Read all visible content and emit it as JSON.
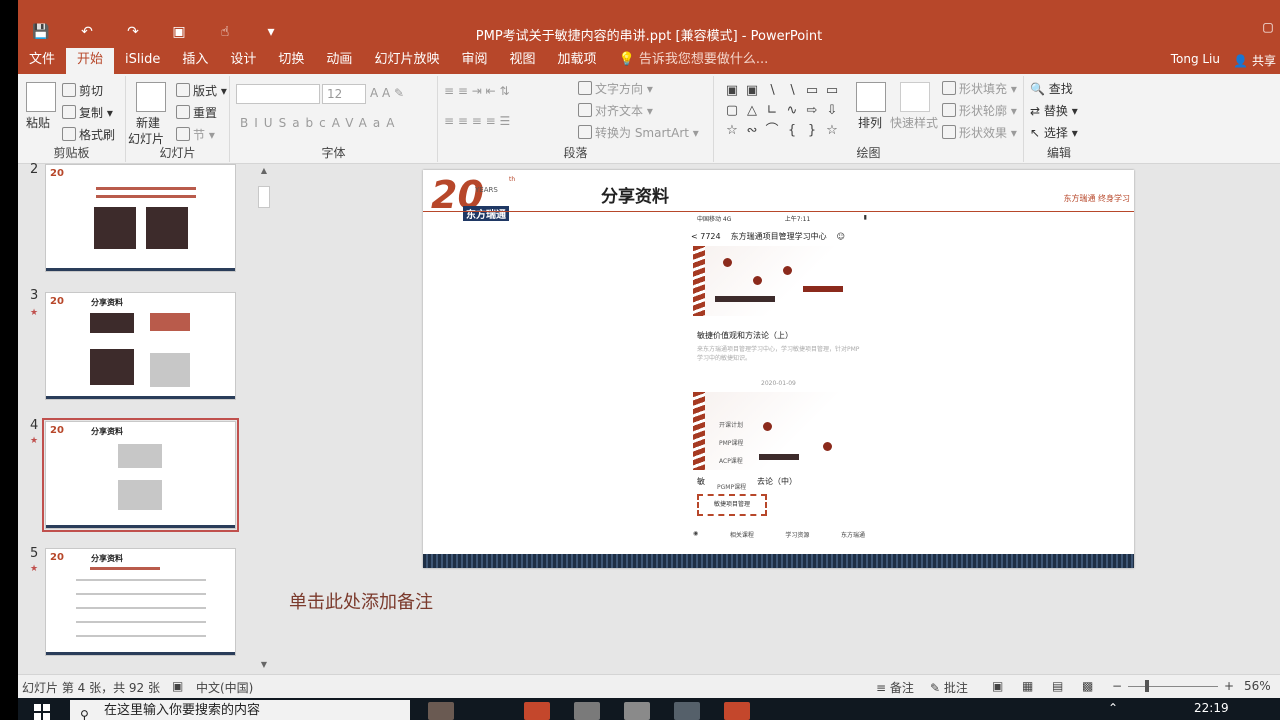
{
  "app": {
    "title": "PMP考试关于敏捷内容的串讲.ppt [兼容模式] - PowerPoint",
    "user": "Tong Liu",
    "share": "共享",
    "colors": {
      "accent": "#b7472a",
      "ribbon_bg": "#f3f3f3"
    }
  },
  "qat": {
    "save_icon": "save-icon",
    "undo_icon": "undo-icon",
    "redo_icon": "redo-icon",
    "present_icon": "present-icon",
    "touch_icon": "touch-mode-icon",
    "customize_icon": "customize-icon"
  },
  "tabs": [
    "文件",
    "开始",
    "iSlide",
    "插入",
    "设计",
    "切换",
    "动画",
    "幻灯片放映",
    "审阅",
    "视图",
    "加载项"
  ],
  "active_tab": "开始",
  "tell_me": "告诉我您想要做什么...",
  "ribbon": {
    "clipboard": {
      "label": "剪贴板",
      "paste": "粘贴",
      "cut": "剪切",
      "copy": "复制",
      "format_painter": "格式刷"
    },
    "slides": {
      "label": "幻灯片",
      "new_slide": "新建",
      "new_slide2": "幻灯片",
      "layout": "版式",
      "reset": "重置",
      "section": "节"
    },
    "font": {
      "label": "字体",
      "font_size": "12",
      "buttons": [
        "B",
        "I",
        "U",
        "S",
        "abc",
        "AV",
        "Aa",
        "A"
      ]
    },
    "paragraph": {
      "label": "段落",
      "text_direction": "文字方向",
      "align_text": "对齐文本",
      "smartart": "转换为 SmartArt"
    },
    "drawing": {
      "label": "绘图",
      "arrange": "排列",
      "quick_styles": "快速样式",
      "shape_fill": "形状填充",
      "shape_outline": "形状轮廓",
      "shape_effects": "形状效果"
    },
    "editing": {
      "label": "编辑",
      "find": "查找",
      "replace": "替换",
      "select": "选择"
    }
  },
  "thumbnails": [
    {
      "num": "2",
      "title": "",
      "star": false
    },
    {
      "num": "3",
      "title": "分享资料",
      "star": true
    },
    {
      "num": "4",
      "title": "分享资料",
      "star": true,
      "selected": true
    },
    {
      "num": "5",
      "title": "分享资料",
      "star": true
    }
  ],
  "slide": {
    "logo_number": "20",
    "logo_years": "YEARS",
    "logo_th": "th",
    "logo_name": "东方瑞通",
    "title": "分享资料",
    "tagline": "东方瑞通  终身学习",
    "phone": {
      "carrier": "中国移动  4G",
      "time": "上午7:11",
      "back": "< 7724",
      "header": "东方瑞通项目管理学习中心",
      "caption1": "敏捷价值观和方法论（上）",
      "sub1": "来东方瑞通项目管理学习中心，学习敏捷项目管理，针对PMP学习中的敏捷知识。",
      "mid": "2020-01-09",
      "menu": [
        "开课计划",
        "PMP课程",
        "ACP课程",
        "PGMP课程"
      ],
      "caption2_a": "敏",
      "caption2_b": "去论（中）",
      "dash_item": "敏捷项目管理",
      "footer": [
        "相关课程",
        "学习资源",
        "东方瑞通"
      ]
    }
  },
  "notes_placeholder": "单击此处添加备注",
  "status": {
    "slide_info": "幻灯片 第 4 张，共 92 张",
    "language": "中文(中国)",
    "notes": "备注",
    "comments": "批注",
    "zoom": "56%"
  },
  "taskbar": {
    "search_placeholder": "在这里输入你要搜索的内容",
    "time": "22:19"
  }
}
